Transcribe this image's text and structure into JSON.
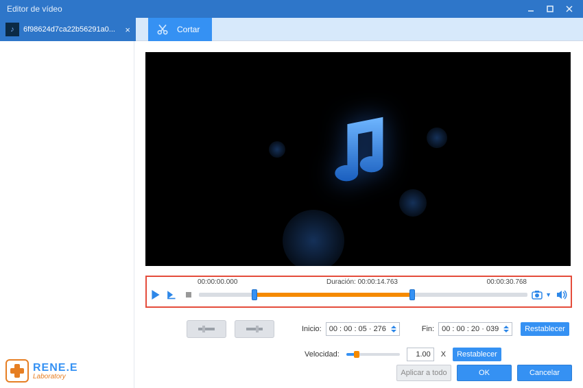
{
  "window": {
    "title": "Editor de vídeo"
  },
  "file_tab": {
    "name": "6f98624d7ca22b56291a0..."
  },
  "tool_tab": {
    "label": "Cortar"
  },
  "timeline": {
    "start": "00:00:00.000",
    "duration_label": "Duración:",
    "duration": "00:00:14.763",
    "total": "00:00:30.768"
  },
  "trim": {
    "start_label": "Inicio:",
    "start_value": "00 : 00 : 05 · 276",
    "end_label": "Fin:",
    "end_value": "00 : 00 : 20 · 039",
    "reset_label": "Restablecer"
  },
  "speed": {
    "label": "Velocidad:",
    "value": "1.00",
    "unit": "X",
    "reset_label": "Restablecer"
  },
  "footer": {
    "apply_all": "Aplicar a todo",
    "ok": "OK",
    "cancel": "Cancelar"
  },
  "logo": {
    "line1": "RENE.E",
    "line2": "Laboratory"
  }
}
